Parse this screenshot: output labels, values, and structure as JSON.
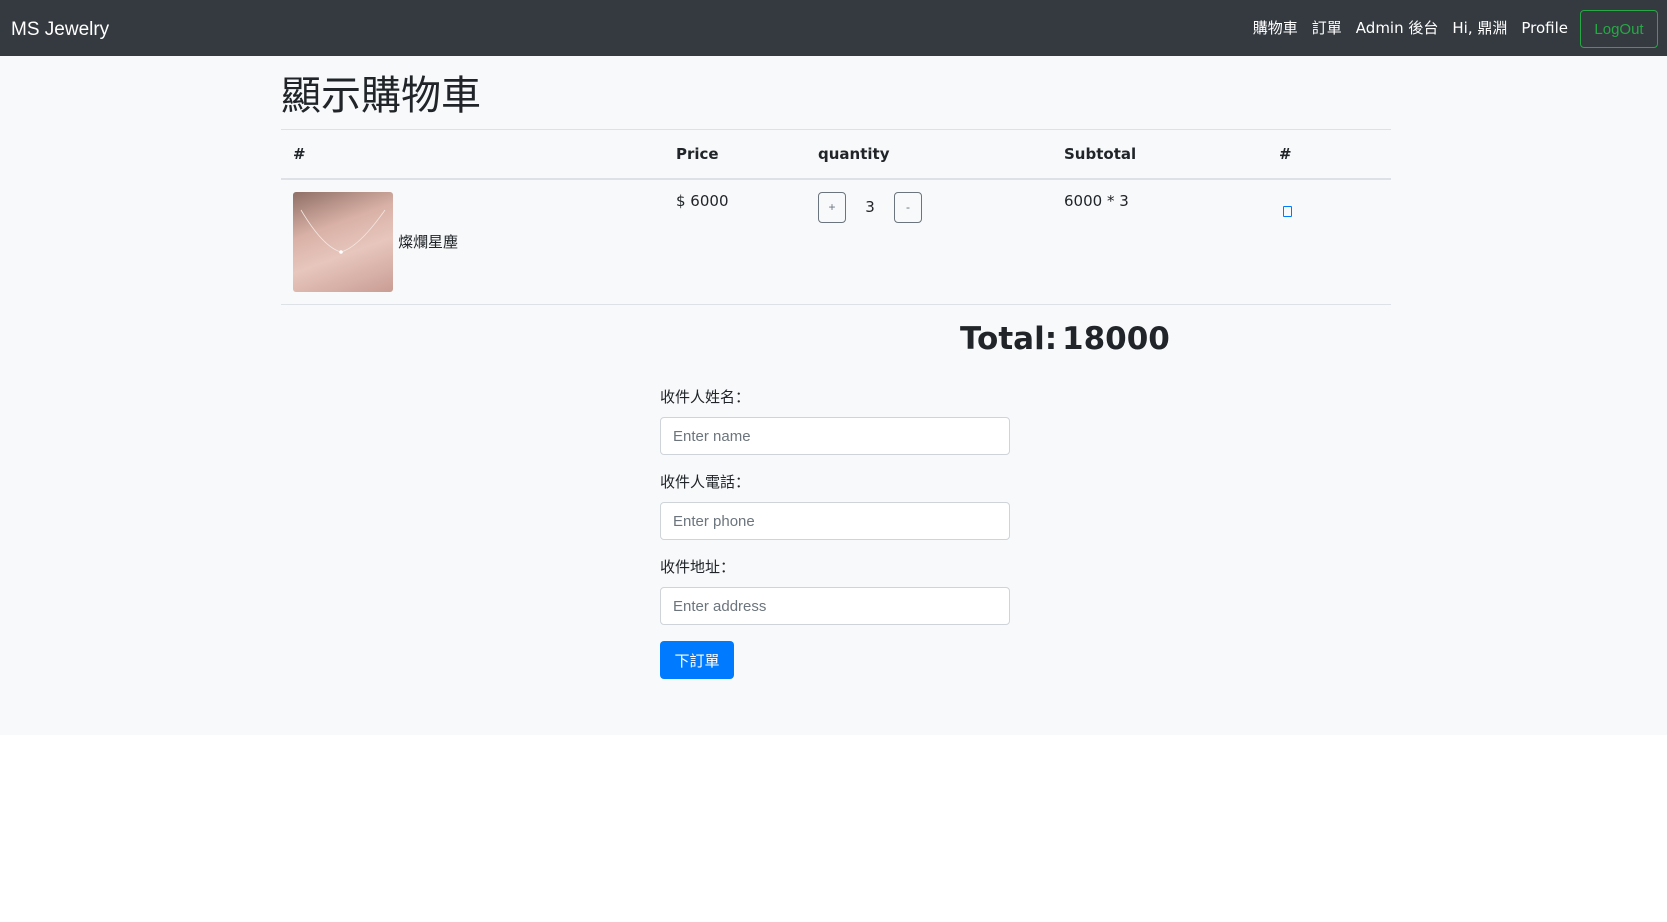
{
  "navbar": {
    "brand": "MS Jewelry",
    "links": [
      "購物車",
      "訂單",
      "Admin 後台",
      "Hi, 鼎淵",
      "Profile"
    ],
    "logout_label": "LogOut",
    "bg_color": "#343a40"
  },
  "page": {
    "title": "顯示購物車"
  },
  "cart": {
    "headers": [
      "#",
      "Price",
      "quantity",
      "Subtotal",
      "#"
    ],
    "rows": [
      {
        "name": "燦爛星塵",
        "price": "$ 6000",
        "quantity": "3",
        "plus_label": "+",
        "minus_label": "-",
        "subtotal": "6000 * 3",
        "action_icon": "trash-icon"
      }
    ],
    "total_label": "Total:",
    "total_value": "18000"
  },
  "form": {
    "name_label": "收件人姓名：",
    "name_placeholder": "Enter name",
    "phone_label": "收件人電話：",
    "phone_placeholder": "Enter phone",
    "address_label": "收件地址：",
    "address_placeholder": "Enter address",
    "submit_label": "下訂單",
    "submit_color": "#007bff"
  }
}
